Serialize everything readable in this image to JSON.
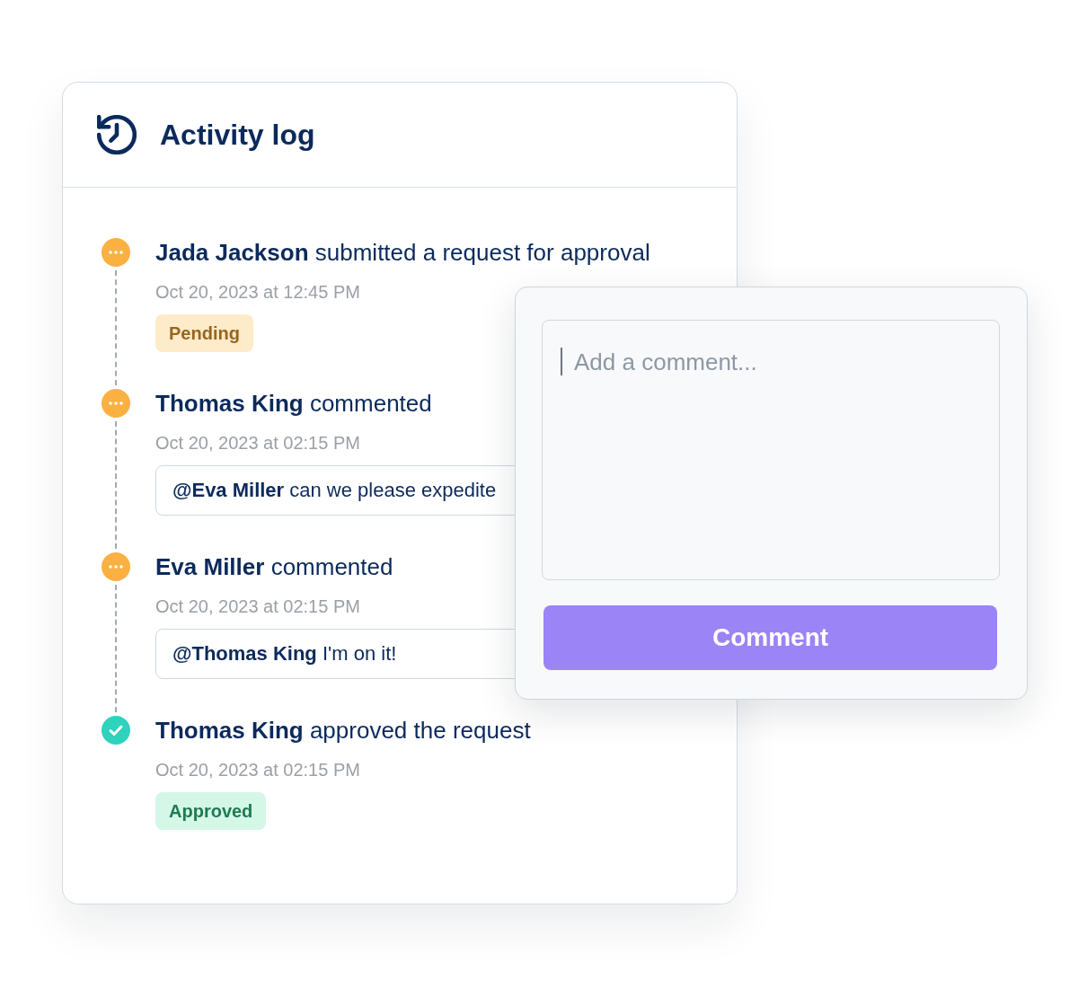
{
  "panel": {
    "title": "Activity log"
  },
  "events": [
    {
      "kind": "status",
      "approved": false,
      "text": "**Jada Jackson** submitted a request for approval",
      "time": "Oct 20, 2023 at 12:45 PM",
      "badge": "Pending"
    },
    {
      "kind": "comment",
      "approved": false,
      "text": "**Thomas King** commented",
      "time": "Oct 20, 2023 at 02:15 PM",
      "comment": "**@Eva Miller** can we please expedite"
    },
    {
      "kind": "comment",
      "approved": false,
      "text": "**Eva Miller** commented",
      "time": "Oct 20, 2023 at 02:15 PM",
      "comment": "**@Thomas King** I'm on it!"
    },
    {
      "kind": "status",
      "approved": true,
      "text": "**Thomas King** approved the request",
      "time": "Oct 20, 2023 at 02:15 PM",
      "badge": "Approved"
    }
  ],
  "comment_form": {
    "placeholder": "Add a comment...",
    "focused": true,
    "button": "Comment"
  }
}
